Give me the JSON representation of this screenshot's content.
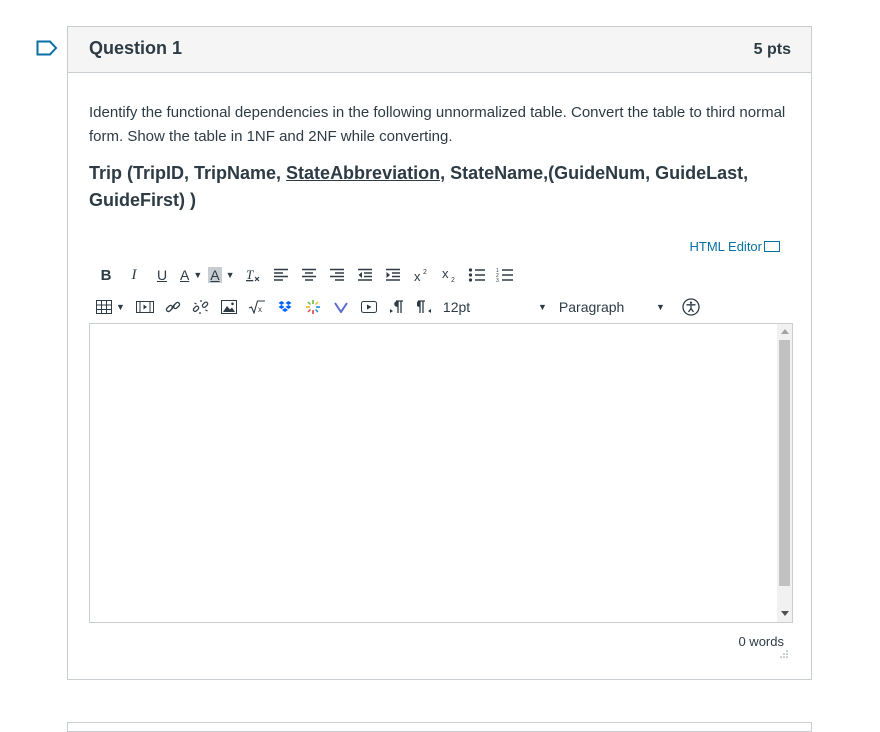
{
  "question": {
    "title": "Question 1",
    "points": "5 pts",
    "text": "Identify the functional dependencies in the following unnormalized table. Convert the table to third normal form. Show the table in 1NF and 2NF while converting.",
    "schema": {
      "prefix": "Trip (TripID, TripName, ",
      "underlined": "StateAbbreviation",
      "suffix": ", StateName,(GuideNum, GuideLast, GuideFirst) )"
    }
  },
  "editor": {
    "html_editor_link": "HTML Editor",
    "font_size": "12pt",
    "block_format": "Paragraph",
    "word_count": "0 words",
    "content": ""
  },
  "colors": {
    "link": "#0770a3",
    "text": "#2d3b45",
    "border": "#c7cdd1",
    "header_bg": "#f5f5f5",
    "flag": "#0770a3"
  }
}
